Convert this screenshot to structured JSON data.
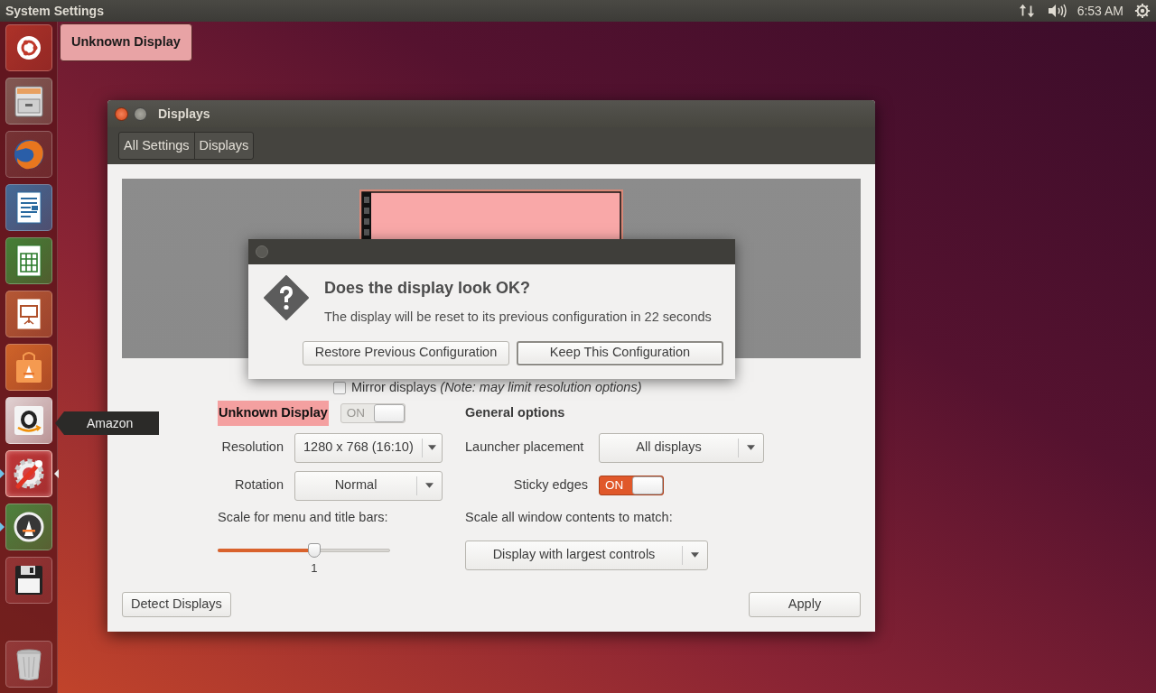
{
  "top_panel": {
    "title": "System Settings",
    "clock": "6:53 AM"
  },
  "launcher": [
    {
      "kind": "dash",
      "running": false,
      "focused": false
    },
    {
      "kind": "files",
      "running": false,
      "focused": false
    },
    {
      "kind": "browser",
      "running": false,
      "focused": false
    },
    {
      "kind": "writer",
      "running": false,
      "focused": false
    },
    {
      "kind": "calc",
      "running": false,
      "focused": false
    },
    {
      "kind": "impress",
      "running": false,
      "focused": false
    },
    {
      "kind": "store",
      "running": false,
      "focused": false
    },
    {
      "kind": "amazon",
      "running": false,
      "focused": false
    },
    {
      "kind": "settings",
      "running": true,
      "focused": true
    },
    {
      "kind": "updater",
      "running": true,
      "focused": false
    },
    {
      "kind": "disk",
      "running": false,
      "focused": false
    },
    {
      "kind": "trash",
      "running": false,
      "focused": false
    }
  ],
  "launcher_tooltip": "Amazon",
  "display_label": "Unknown Display",
  "window": {
    "title": "Displays",
    "breadcrumbs": [
      {
        "label": "All Settings"
      },
      {
        "label": "Displays"
      }
    ],
    "mirror": {
      "text": "Mirror displays *(Note: may limit resolution options)*",
      "checked": false
    },
    "display_settings": {
      "name": "Unknown Display",
      "toggle": {
        "label": "ON",
        "on": true,
        "disabled": true
      },
      "fields": [
        {
          "label": "Resolution",
          "value": "1280 x 768 (16:10)"
        },
        {
          "label": "Rotation",
          "value": "Normal"
        }
      ],
      "scale": {
        "label": "Scale for menu and title bars:",
        "level": 0.56,
        "reading": "1"
      }
    },
    "general_options": {
      "title": "General options",
      "launcher_placement": {
        "label": "Launcher placement",
        "value": "All displays"
      },
      "sticky_edges": {
        "label": "Sticky edges",
        "toggle": {
          "label": "ON",
          "on": true,
          "disabled": false
        }
      },
      "scale_all": {
        "label": "Scale all window contents to match:",
        "value": "Display with largest controls"
      }
    },
    "buttons": [
      {
        "label": "Detect Displays"
      },
      {
        "label": "Apply"
      }
    ]
  },
  "dialog": {
    "title": "Does the display look OK?",
    "message": "The display will be reset to its previous configuration in 22 seconds",
    "buttons": [
      {
        "label": "Restore Previous Configuration",
        "default": false
      },
      {
        "label": "Keep This Configuration",
        "default": true
      }
    ]
  }
}
